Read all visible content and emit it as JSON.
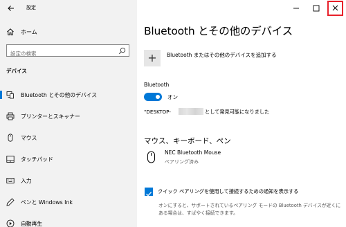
{
  "window": {
    "title": "設定"
  },
  "sidebar": {
    "home_label": "ホーム",
    "search_placeholder": "設定の検索",
    "section_label": "デバイス",
    "items": [
      {
        "label": "Bluetooth とその他のデバイス",
        "icon": "bluetooth-devices-icon",
        "selected": true
      },
      {
        "label": "プリンターとスキャナー",
        "icon": "printer-icon",
        "selected": false
      },
      {
        "label": "マウス",
        "icon": "mouse-icon",
        "selected": false
      },
      {
        "label": "タッチパッド",
        "icon": "touchpad-icon",
        "selected": false
      },
      {
        "label": "入力",
        "icon": "keyboard-icon",
        "selected": false
      },
      {
        "label": "ペンと Windows Ink",
        "icon": "pen-icon",
        "selected": false
      },
      {
        "label": "自動再生",
        "icon": "autoplay-icon",
        "selected": false
      }
    ]
  },
  "main": {
    "title": "Bluetooth とその他のデバイス",
    "add_device_label": "Bluetooth またはその他のデバイスを追加する",
    "bluetooth_heading": "Bluetooth",
    "toggle_state": "オン",
    "discoverable_prefix": "\"DESKTOP-",
    "discoverable_suffix": "として発見可能になりました",
    "mouse_section_heading": "マウス、キーボード、ペン",
    "device": {
      "name": "NEC Bluetooth Mouse",
      "status": "ペアリング済み"
    },
    "swift_pair_label": "クイック ペアリングを使用して接続するための通知を表示する",
    "swift_pair_description": "オンにすると、サポートされているペアリング モードの Bluetooth デバイスが近くにある場合は、すばやく接続できます。"
  },
  "colors": {
    "accent": "#0078d7",
    "highlight": "#e8202a",
    "sidebar_bg": "#f2f2f2"
  }
}
